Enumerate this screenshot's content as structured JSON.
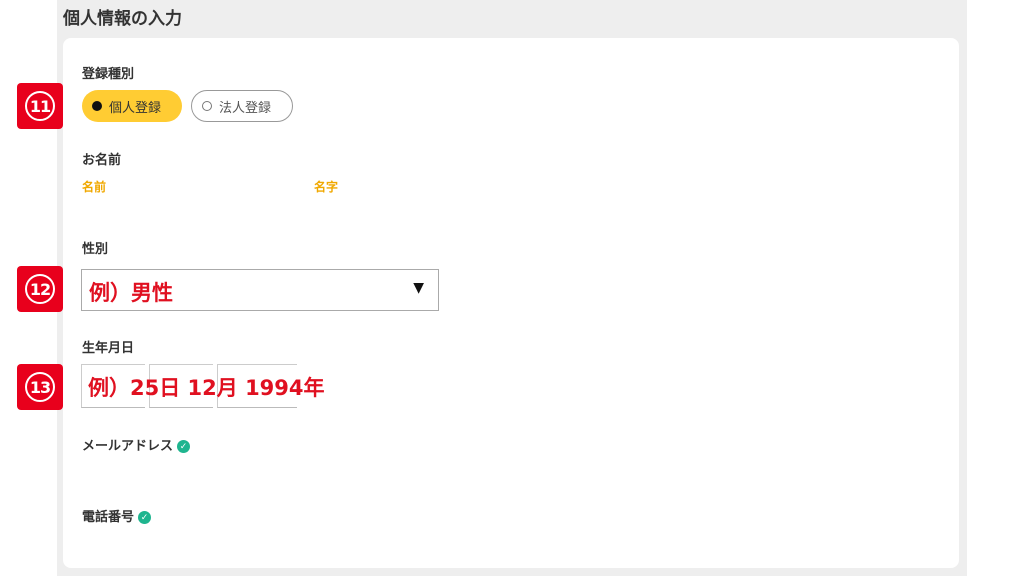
{
  "section": {
    "title": "個人情報の入力"
  },
  "registration": {
    "label": "登録種別",
    "options": [
      {
        "label": "個人登録",
        "selected": true
      },
      {
        "label": "法人登録",
        "selected": false
      }
    ]
  },
  "name": {
    "label": "お名前",
    "first_label": "名前",
    "last_label": "名字"
  },
  "gender": {
    "label": "性別",
    "example": "例）男性"
  },
  "birthday": {
    "label": "生年月日",
    "example": "例）25日 12月 1994年"
  },
  "email": {
    "label": "メールアドレス"
  },
  "phone": {
    "label": "電話番号"
  },
  "badges": [
    "11",
    "12",
    "13"
  ],
  "colors": {
    "accent": "#ffcc33",
    "badge": "#e8001c",
    "example_text": "#e01020",
    "sublabel": "#f0a800",
    "verified": "#1fb58f"
  }
}
